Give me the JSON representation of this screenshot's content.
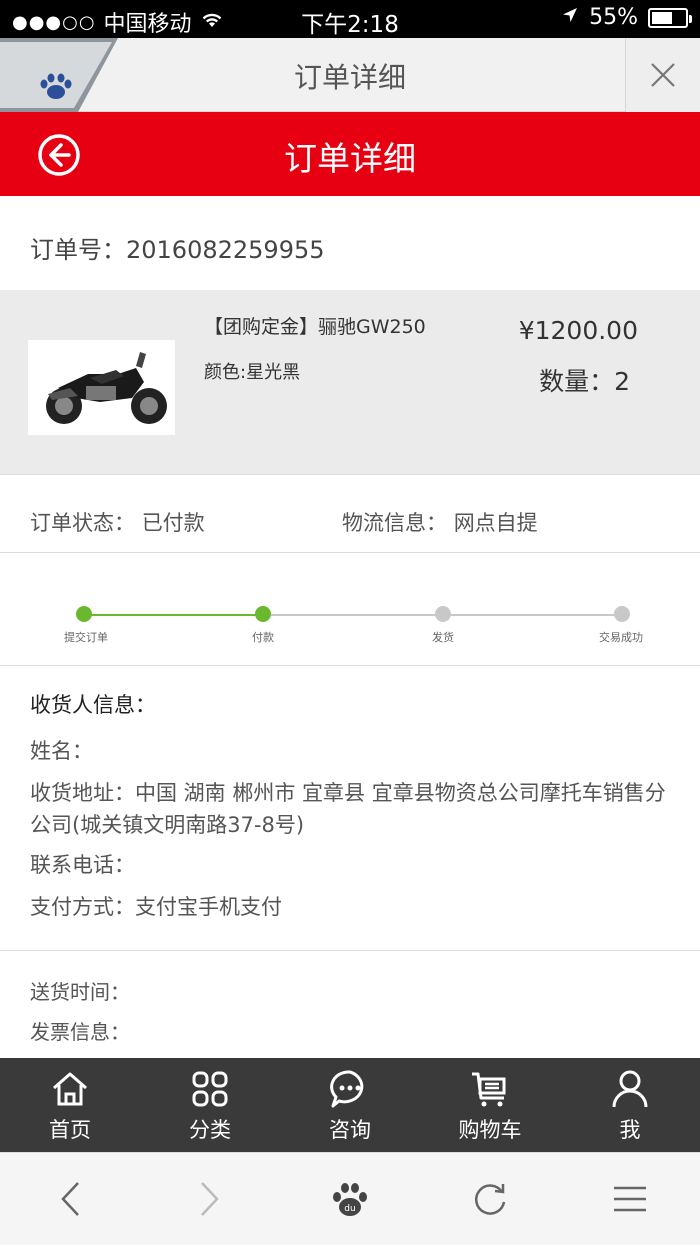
{
  "status_bar": {
    "signal_dots": "●●●○○",
    "carrier": "中国移动",
    "wifi_icon": "wifi-icon",
    "time": "下午2:18",
    "battery": "55%"
  },
  "browser": {
    "title": "订单详细"
  },
  "header": {
    "title": "订单详细"
  },
  "order": {
    "number_label": "订单号：",
    "number": "2016082259955"
  },
  "product": {
    "name": "【团购定金】骊驰GW250",
    "color": "颜色:星光黑",
    "price": "¥1200.00",
    "quantity": "数量：2"
  },
  "status": {
    "order_status_label": "订单状态：",
    "order_status": "已付款",
    "logistics_label": "物流信息：",
    "logistics": "网点自提"
  },
  "progress": {
    "completed": 2,
    "steps": [
      "提交订单",
      "付款",
      "发货",
      "交易成功"
    ],
    "active_color": "#6ab82e",
    "inactive_color": "#c8c8c8"
  },
  "receiver": {
    "heading": "收货人信息：",
    "name_label": "姓名：",
    "address_label": "收货地址：",
    "address": "中国 湖南 郴州市 宜章县  宜章县物资总公司摩托车销售分公司(城关镇文明南路37-8号)",
    "phone_label": "联系电话：",
    "payment_label": "支付方式：",
    "payment": "支付宝手机支付"
  },
  "extra": {
    "delivery_label": "送货时间：",
    "invoice_label": "发票信息："
  },
  "bottom_nav": [
    {
      "label": "首页",
      "icon": "home-icon"
    },
    {
      "label": "分类",
      "icon": "category-icon"
    },
    {
      "label": "咨询",
      "icon": "chat-icon"
    },
    {
      "label": "购物车",
      "icon": "cart-icon"
    },
    {
      "label": "我",
      "icon": "user-icon"
    }
  ],
  "colors": {
    "brand_red": "#e60012",
    "nav_dark": "#3a3a3a"
  }
}
